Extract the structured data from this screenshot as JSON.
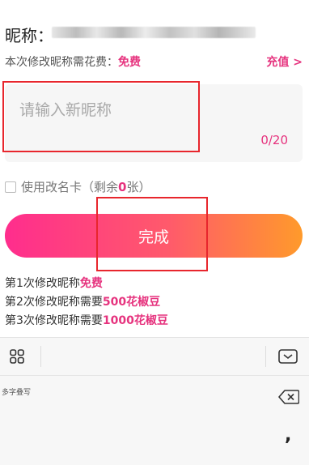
{
  "nickname": {
    "label": "昵称："
  },
  "fee": {
    "prefix": "本次修改昵称需花费：",
    "value": "免费"
  },
  "recharge_label": "充值 >",
  "new_nickname": {
    "placeholder": "请输入新昵称",
    "value": "",
    "counter": "0/20"
  },
  "rename_card": {
    "prefix": "使用改名卡（剩余",
    "count": "0",
    "suffix": "张）",
    "checked": false
  },
  "done_label": "完成",
  "rules": [
    {
      "prefix": "第1次修改昵称",
      "highlight": "免费"
    },
    {
      "prefix": "第2次修改昵称需要",
      "highlight": "500花椒豆"
    },
    {
      "prefix": "第3次修改昵称需要",
      "highlight": "1000花椒豆"
    }
  ],
  "keyboard": {
    "handwriting_label": "多字叠写",
    "punctuation_key": ",",
    "icons": [
      "grid-icon",
      "collapse-keyboard-icon",
      "backspace-icon"
    ]
  },
  "colors": {
    "accent": "#e6337e",
    "gradient_start": "#ff2d8d",
    "gradient_end": "#ff9a2b",
    "highlight_box": "#e8262d"
  }
}
